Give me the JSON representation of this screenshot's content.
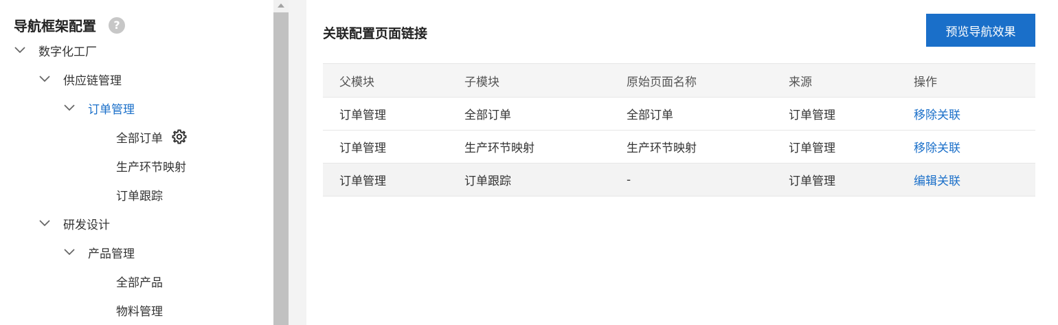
{
  "sidebar": {
    "title": "导航框架配置",
    "help_icon": "?",
    "tree": [
      {
        "label": "数字化工厂",
        "level": 0,
        "expanded": true
      },
      {
        "label": "供应链管理",
        "level": 1,
        "expanded": true
      },
      {
        "label": "订单管理",
        "level": 2,
        "expanded": true,
        "active": true
      },
      {
        "label": "全部订单",
        "level": 3,
        "has_settings": true
      },
      {
        "label": "生产环节映射",
        "level": 3
      },
      {
        "label": "订单跟踪",
        "level": 3
      },
      {
        "label": "研发设计",
        "level": 1,
        "expanded": true
      },
      {
        "label": "产品管理",
        "level": 2,
        "expanded": true
      },
      {
        "label": "全部产品",
        "level": 3
      },
      {
        "label": "物料管理",
        "level": 3
      }
    ]
  },
  "main": {
    "title": "关联配置页面链接",
    "preview_button": "预览导航效果",
    "table": {
      "headers": [
        "父模块",
        "子模块",
        "原始页面名称",
        "来源",
        "操作"
      ],
      "rows": [
        [
          "订单管理",
          "全部订单",
          "全部订单",
          "订单管理",
          "移除关联"
        ],
        [
          "订单管理",
          "生产环节映射",
          "生产环节映射",
          "订单管理",
          "移除关联"
        ],
        [
          "订单管理",
          "订单跟踪",
          "-",
          "订单管理",
          "编辑关联"
        ]
      ]
    }
  },
  "colors": {
    "accent": "#1a6fc9",
    "scroll_thumb": "#c1c1c1",
    "gutter": "#f3f3f3"
  }
}
